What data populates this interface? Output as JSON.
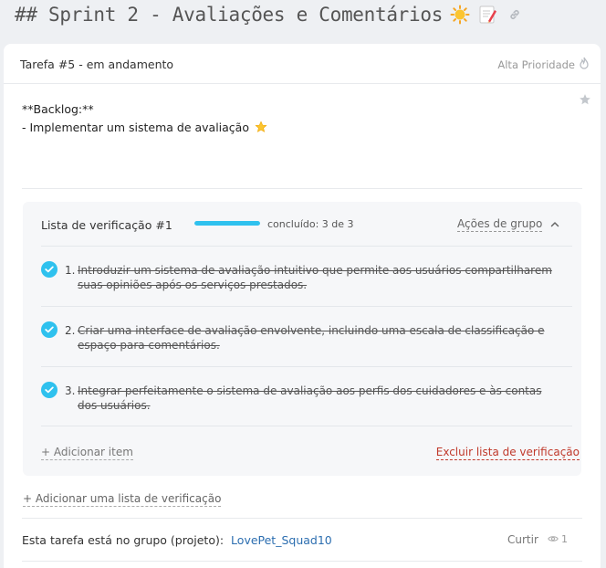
{
  "title": "## Sprint 2 - Avaliações e Comentários",
  "title_icons": [
    "sun-emoji-icon",
    "memo-emoji-icon",
    "link-icon"
  ],
  "task": {
    "name": "Tarefa #5 - em andamento",
    "priority": "Alta Prioridade",
    "priority_icon": "flame-icon",
    "star_icon": "star-icon"
  },
  "description": {
    "line1": "**Backlog:**",
    "line2": "- Implementar um sistema de avaliação",
    "line2_icon": "star-emoji-icon"
  },
  "checklist": {
    "title": "Lista de verificação #1",
    "progress_text": "concluído: 3 de 3",
    "progress_fraction": 1.0,
    "group_actions": "Ações de grupo",
    "items": [
      {
        "num": "1.",
        "text": "Introduzir um sistema de avaliação intuitivo que permite aos usuários compartilharem suas opiniões após os serviços prestados.",
        "done": true
      },
      {
        "num": "2.",
        "text": "Criar uma interface de avaliação envolvente, incluindo uma escala de classificação e espaço para comentários.",
        "done": true
      },
      {
        "num": "3.",
        "text": "Integrar perfeitamente o sistema de avaliação aos perfis dos cuidadores e às contas dos usuários.",
        "done": true
      }
    ],
    "add_item": "+ Adicionar item",
    "delete_list": "Excluir lista de verificação"
  },
  "add_checklist": "+ Adicionar uma lista de verificação",
  "footer": {
    "group_text": "Esta tarefa está no grupo (projeto):",
    "project_link": "LovePet_Squad10",
    "like": "Curtir",
    "views": "1"
  },
  "colors": {
    "accent": "#2fc1ee",
    "danger": "#c0392b",
    "link": "#2c6eb0"
  }
}
